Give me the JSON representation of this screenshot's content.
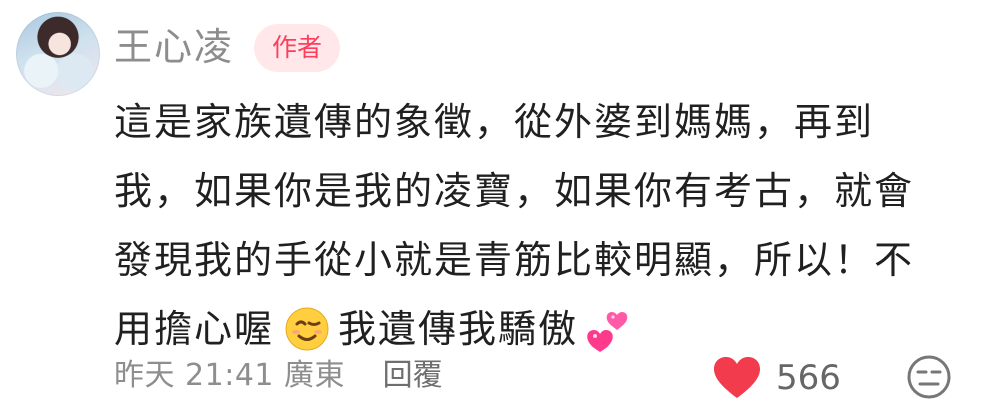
{
  "user": {
    "name": "王心凌",
    "badge": "作者"
  },
  "comment": {
    "line1": "這是家族遺傳的象徵，從外婆到媽媽，再到",
    "line2": "我，如果你是我的凌寶，如果你有考古，就會",
    "line3": "發現我的手從小就是青筋比較明顯，所以！不",
    "line4_a": "用擔心喔",
    "line4_b": "我遺傳我驕傲"
  },
  "meta": {
    "time": "昨天 21:41 廣東",
    "reply": "回覆"
  },
  "likes": {
    "count": "566",
    "color": "#f23b4c"
  },
  "icons": {
    "wink": "wink-emoji",
    "hearts": "two-hearts-emoji",
    "like": "heart-icon",
    "react": "neutral-face-icon"
  }
}
